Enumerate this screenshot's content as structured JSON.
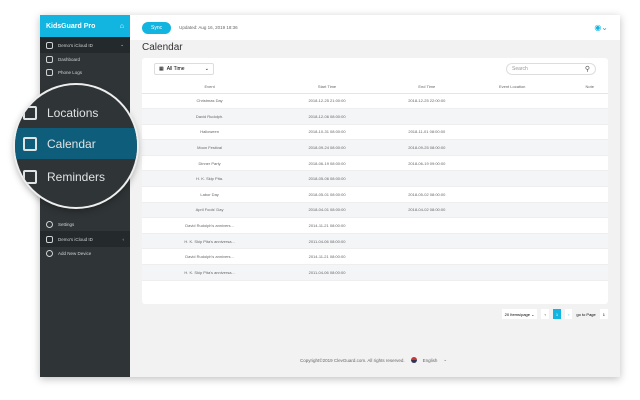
{
  "app": {
    "name": "KidsGuard Pro",
    "sync": "Sync",
    "updated": "Updated: Aug 16, 2019 18:36"
  },
  "sidebar": {
    "device1": "Demo's iCloud ID",
    "items": [
      "Dashboard",
      "Phone Logs"
    ],
    "settings": "Settings",
    "device2": "Demo's iCloud ID",
    "add": "Add New Device"
  },
  "magnifier": [
    "Locations",
    "Calendar",
    "Reminders"
  ],
  "page": {
    "title": "Calendar",
    "filter": "All Time",
    "search_placeholder": "Search"
  },
  "table": {
    "headers": [
      "Event",
      "Start Time",
      "End Time",
      "Event Location",
      "Note"
    ],
    "rows": [
      [
        "Christmas Day",
        "2018-12-25 21:00:00",
        "2018-12-25 22:00:00"
      ],
      [
        "David Rudolph.",
        "2018-12-06 08:00:00",
        ""
      ],
      [
        "Halloween",
        "2018-10-31 08:00:00",
        "2018-11-01 08:00:00"
      ],
      [
        "Moon Festival",
        "2018-09-24 08:00:00",
        "2018-09-25 08:00:00"
      ],
      [
        "Dinner Party",
        "2018-06-19 08:00:00",
        "2018-06-19 09:00:00"
      ],
      [
        "H. K. Skip Pita.",
        "2018-05-06 08:00:00",
        ""
      ],
      [
        "Labor Day",
        "2018-05-01 08:00:00",
        "2018-05-02 08:00:00"
      ],
      [
        "April Fools' Day",
        "2018-04-01 08:00:00",
        "2018-04-02 08:00:00"
      ],
      [
        "David Rudolph's annivers...",
        "2014-11-21 08:00:00",
        ""
      ],
      [
        "H. K. Skip Pita's anniversa...",
        "2011-04-06 08:00:00",
        ""
      ],
      [
        "David Rudolph's annivers...",
        "2014-11-21 08:00:00",
        ""
      ],
      [
        "H. K. Skip Pita's anniversa...",
        "2011-04-06 08:00:00",
        ""
      ]
    ]
  },
  "pager": {
    "per_page": "20 Items/page",
    "current": "1",
    "goto": "go to Page",
    "goto_value": "1"
  },
  "footer": {
    "copyright": "Copyright©2019 ClevGuard.com. All rights reserved.",
    "lang": "English"
  },
  "colors": {
    "accent": "#12b4e0",
    "sidebar": "#2f3436"
  }
}
